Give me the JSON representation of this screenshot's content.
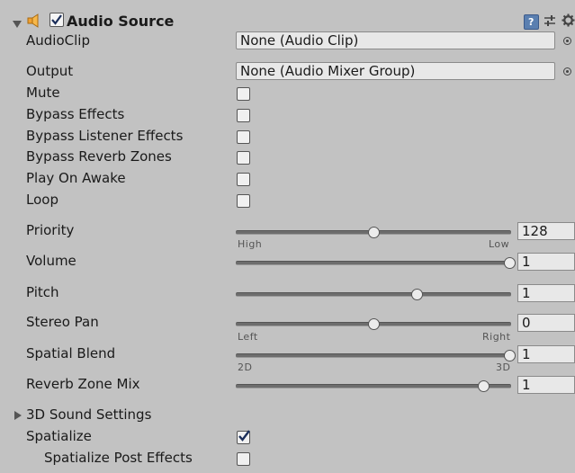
{
  "component": {
    "title": "Audio Source",
    "enabled": true,
    "icons": [
      "speaker-icon",
      "help-icon",
      "preset-icon",
      "gear-icon"
    ]
  },
  "audio_clip": {
    "label": "AudioClip",
    "value": "None (Audio Clip)"
  },
  "output": {
    "label": "Output",
    "value": "None (Audio Mixer Group)"
  },
  "toggles": [
    {
      "label": "Mute",
      "checked": false
    },
    {
      "label": "Bypass Effects",
      "checked": false
    },
    {
      "label": "Bypass Listener Effects",
      "checked": false
    },
    {
      "label": "Bypass Reverb Zones",
      "checked": false
    },
    {
      "label": "Play On Awake",
      "checked": false
    },
    {
      "label": "Loop",
      "checked": false
    }
  ],
  "sliders": [
    {
      "label": "Priority",
      "value": "128",
      "position": 0.5,
      "min_label": "High",
      "max_label": "Low"
    },
    {
      "label": "Volume",
      "value": "1",
      "position": 1.0
    },
    {
      "label": "Pitch",
      "value": "1",
      "position": 0.66
    },
    {
      "label": "Stereo Pan",
      "value": "0",
      "position": 0.5,
      "min_label": "Left",
      "max_label": "Right"
    },
    {
      "label": "Spatial Blend",
      "value": "1",
      "position": 1.0,
      "min_label": "2D",
      "max_label": "3D"
    },
    {
      "label": "Reverb Zone Mix",
      "value": "1",
      "position": 0.9
    }
  ],
  "sound_settings": {
    "label": "3D Sound Settings",
    "expanded": false
  },
  "spatialize": {
    "label": "Spatialize",
    "checked": true
  },
  "spatialize_post": {
    "label": "Spatialize Post Effects",
    "checked": false
  },
  "colors": {
    "panel": "#c2c2c2",
    "field": "#e8e8e8",
    "help": "#5a7fb0"
  }
}
